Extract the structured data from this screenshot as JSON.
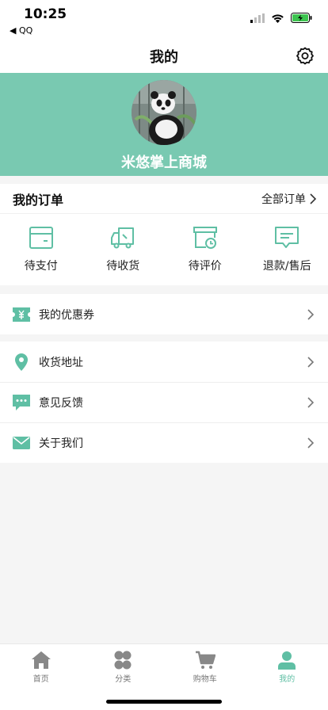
{
  "status_bar": {
    "time": "10:25",
    "back_app": "◀ QQ"
  },
  "nav": {
    "title": "我的"
  },
  "profile": {
    "shop_name": "米悠掌上商城"
  },
  "orders": {
    "title": "我的订单",
    "all_label": "全部订单",
    "items": [
      {
        "label": "待支付",
        "icon": "wallet-icon"
      },
      {
        "label": "待收货",
        "icon": "truck-icon"
      },
      {
        "label": "待评价",
        "icon": "review-clock-icon"
      },
      {
        "label": "退款/售后",
        "icon": "refund-message-icon"
      }
    ]
  },
  "menu": {
    "coupons": {
      "label": "我的优惠券",
      "icon": "coupon-icon"
    },
    "address": {
      "label": "收货地址",
      "icon": "location-pin-icon"
    },
    "feedback": {
      "label": "意见反馈",
      "icon": "chat-bubble-icon"
    },
    "about": {
      "label": "关于我们",
      "icon": "envelope-icon"
    }
  },
  "tabbar": {
    "tabs": [
      {
        "label": "首页",
        "icon": "home-icon"
      },
      {
        "label": "分类",
        "icon": "category-icon"
      },
      {
        "label": "购物车",
        "icon": "cart-icon"
      },
      {
        "label": "我的",
        "icon": "user-icon"
      }
    ],
    "active": "我的"
  },
  "colors": {
    "accent": "#79c9b1",
    "icon_accent": "#5fbfa4",
    "background": "#f5f5f5",
    "tab_inactive": "#777777"
  }
}
